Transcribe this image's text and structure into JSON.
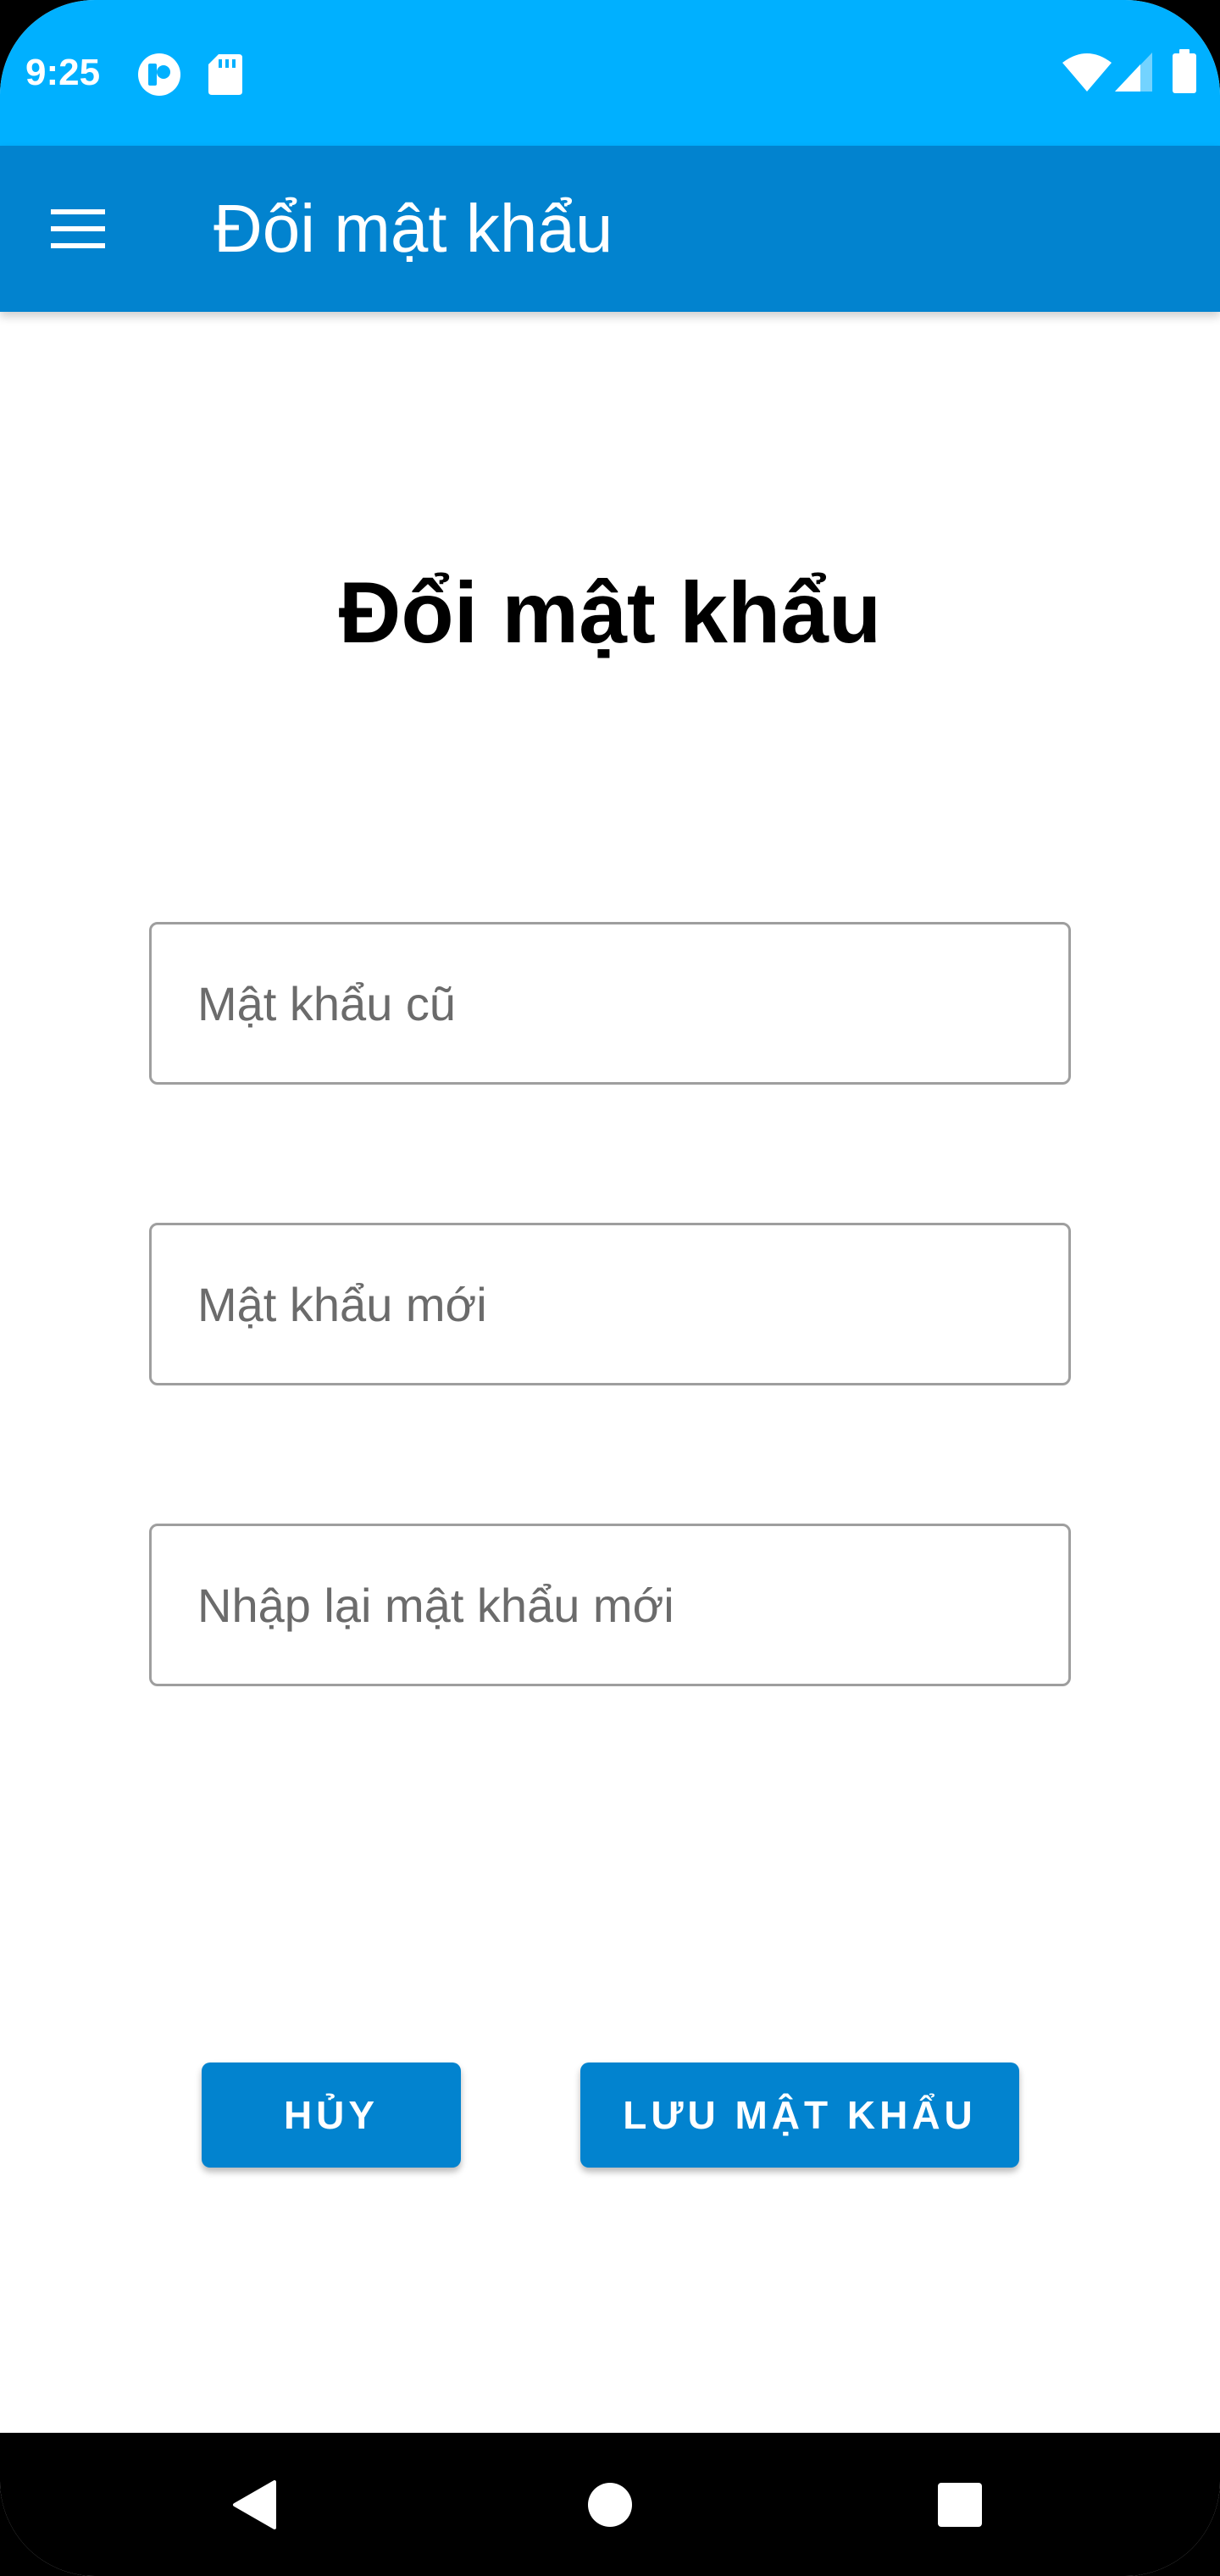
{
  "status_bar": {
    "time": "9:25",
    "left_icons": [
      "app-notification-icon",
      "sd-card-icon"
    ],
    "right_icons": [
      "wifi-icon",
      "cellular-signal-icon",
      "battery-icon"
    ]
  },
  "app_bar": {
    "menu_icon": "hamburger-menu-icon",
    "title": "Đổi mật khẩu"
  },
  "form": {
    "heading": "Đổi mật khẩu",
    "old_password": {
      "placeholder": "Mật khẩu cũ",
      "value": ""
    },
    "new_password": {
      "placeholder": "Mật khẩu mới",
      "value": ""
    },
    "confirm_password": {
      "placeholder": "Nhập lại mật khẩu mới",
      "value": ""
    }
  },
  "actions": {
    "cancel_label": "HỦY",
    "save_label": "LƯU MẬT KHẨU"
  },
  "nav_bar": {
    "icons": [
      "back-icon",
      "home-icon",
      "recents-icon"
    ]
  },
  "colors": {
    "status_bar": "#00B0FF",
    "primary": "#0283CF",
    "background": "#FFFFFF",
    "field_border": "#9E9E9E",
    "placeholder": "#6B6B6B",
    "nav_bar": "#000000"
  }
}
